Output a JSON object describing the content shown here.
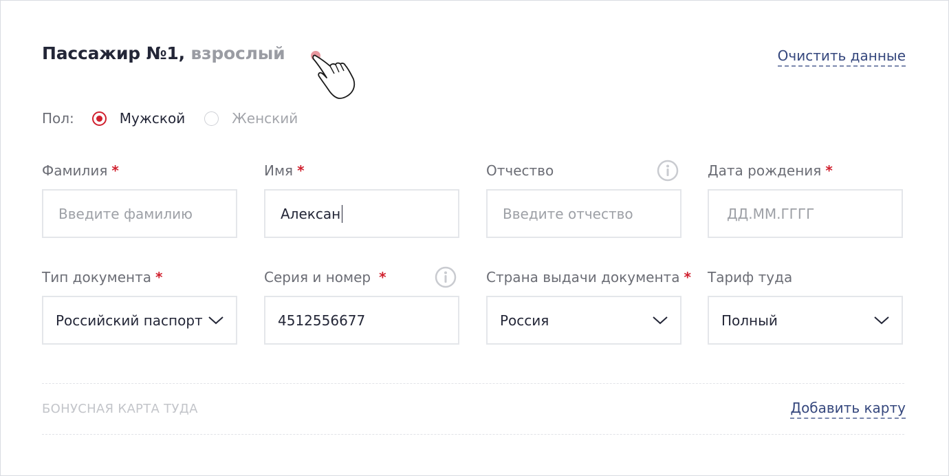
{
  "header": {
    "title": "Пассажир №1,",
    "subtitle": "взрослый",
    "clear_link": "Очистить данные"
  },
  "gender": {
    "label": "Пол:",
    "options": [
      {
        "label": "Мужской",
        "selected": true
      },
      {
        "label": "Женский",
        "selected": false
      }
    ]
  },
  "fields": {
    "last_name": {
      "label": "Фамилия",
      "required": "*",
      "value": "",
      "placeholder": "Введите фамилию"
    },
    "first_name": {
      "label": "Имя",
      "required": "*",
      "value": "Алексан",
      "placeholder": ""
    },
    "patronymic": {
      "label": "Отчество",
      "value": "",
      "placeholder": "Введите отчество",
      "icon": "info-icon"
    },
    "birth_date": {
      "label": "Дата рождения",
      "required": "*",
      "value": "",
      "placeholder": "ДД.ММ.ГГГГ"
    },
    "doc_type": {
      "label": "Тип документа",
      "required": "*",
      "value": "Российский паспорт"
    },
    "doc_number": {
      "label": "Серия и номер",
      "required": "*",
      "value": "4512556677",
      "icon": "info-icon"
    },
    "doc_country": {
      "label": "Страна выдачи документа",
      "required": "*",
      "value": "Россия"
    },
    "tariff": {
      "label": "Тариф туда",
      "value": "Полный"
    }
  },
  "bonus": {
    "label": "БОНУСНАЯ КАРТА ТУДА",
    "add_link": "Добавить карту"
  },
  "colors": {
    "accent_red": "#d0202e",
    "link_blue": "#35477d",
    "title_dark": "#232637"
  }
}
